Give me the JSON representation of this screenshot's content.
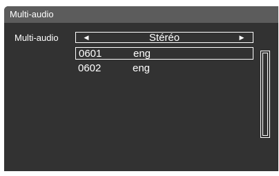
{
  "window": {
    "title": "Multi-audio"
  },
  "setting": {
    "label": "Multi-audio",
    "value": "Stéréo",
    "left_arrow": "◀",
    "right_arrow": "▶"
  },
  "tracks": [
    {
      "pid": "0601",
      "lang": "eng",
      "selected": true
    },
    {
      "pid": "0602",
      "lang": "eng",
      "selected": false
    }
  ],
  "icons": {
    "left_arrow": "left-triangle-icon",
    "right_arrow": "right-triangle-icon"
  },
  "colors": {
    "panel": "#323232",
    "title_bar": "#5c5c5c",
    "text": "#ffffff"
  }
}
